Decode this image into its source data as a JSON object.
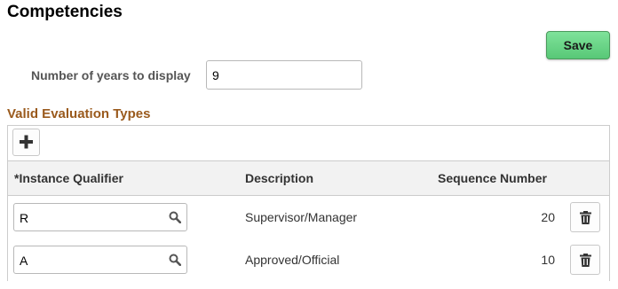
{
  "page": {
    "title": "Competencies"
  },
  "toolbar": {
    "save_label": "Save"
  },
  "settings": {
    "years_label": "Number of years to display",
    "years_value": "9"
  },
  "evaluation_types": {
    "section_title": "Valid Evaluation Types",
    "columns": {
      "qualifier": "*Instance Qualifier",
      "description": "Description",
      "sequence": "Sequence Number"
    },
    "rows": [
      {
        "qualifier": "R",
        "description": "Supervisor/Manager",
        "sequence": "20"
      },
      {
        "qualifier": "A",
        "description": "Approved/Official",
        "sequence": "10"
      }
    ]
  },
  "icons": {
    "add": "plus-icon",
    "lookup": "search-icon",
    "delete": "trash-icon"
  },
  "colors": {
    "save_button": "#6ad487",
    "section_title": "#9a5a1d",
    "header_background": "#f2f2f2"
  }
}
